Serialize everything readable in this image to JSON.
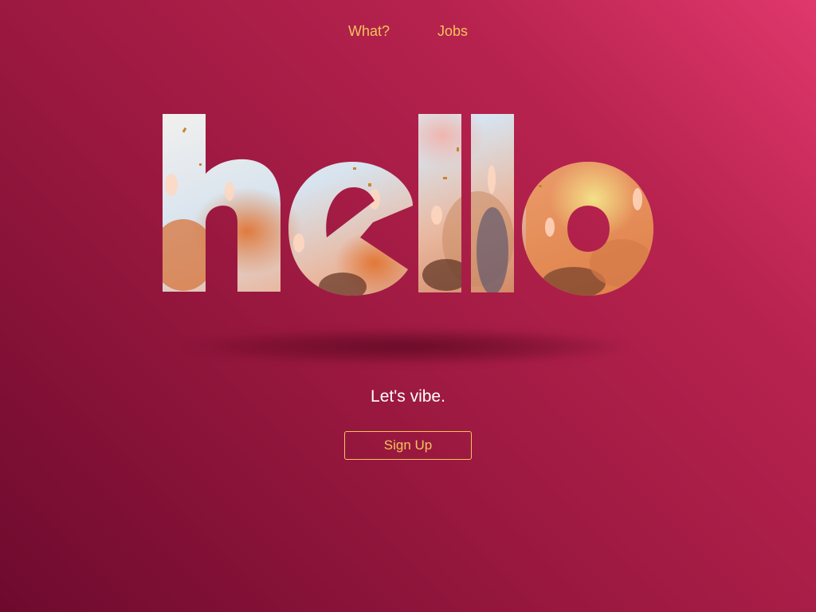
{
  "nav": {
    "items": [
      {
        "label": "What?"
      },
      {
        "label": "Jobs"
      }
    ]
  },
  "hero": {
    "word": "hello",
    "tagline": "Let's vibe.",
    "signup_label": "Sign Up"
  },
  "colors": {
    "accent": "#f3c35a",
    "background_dark": "#6e0a2e",
    "background_light": "#e0386c",
    "text": "#ffffff"
  }
}
